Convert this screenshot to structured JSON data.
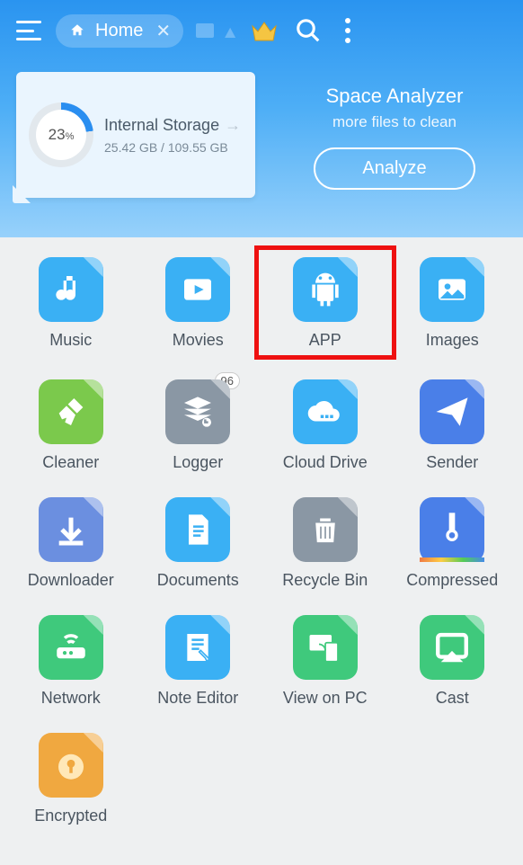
{
  "topbar": {
    "tab_label": "Home"
  },
  "storage": {
    "percent": "23",
    "percent_unit": "%",
    "title": "Internal Storage",
    "used": "25.42 GB",
    "total": "109.55 GB"
  },
  "analyzer": {
    "title": "Space Analyzer",
    "subtitle": "more files to clean",
    "button": "Analyze"
  },
  "tiles": [
    {
      "id": "music",
      "label": "Music",
      "color": "#3ab0f4",
      "icon": "music"
    },
    {
      "id": "movies",
      "label": "Movies",
      "color": "#3ab0f4",
      "icon": "play"
    },
    {
      "id": "app",
      "label": "APP",
      "color": "#3ab0f4",
      "icon": "android",
      "highlight": true
    },
    {
      "id": "images",
      "label": "Images",
      "color": "#3ab0f4",
      "icon": "image"
    },
    {
      "id": "cleaner",
      "label": "Cleaner",
      "color": "#7bc94c",
      "icon": "broom"
    },
    {
      "id": "logger",
      "label": "Logger",
      "color": "#8a97a4",
      "icon": "stack",
      "badge": "96"
    },
    {
      "id": "clouddrive",
      "label": "Cloud Drive",
      "color": "#3ab0f4",
      "icon": "cloud"
    },
    {
      "id": "sender",
      "label": "Sender",
      "color": "#4a7fe8",
      "icon": "send"
    },
    {
      "id": "downloader",
      "label": "Downloader",
      "color": "#6b8fe0",
      "icon": "download"
    },
    {
      "id": "documents",
      "label": "Documents",
      "color": "#3ab0f4",
      "icon": "doc"
    },
    {
      "id": "recyclebin",
      "label": "Recycle Bin",
      "color": "#8a97a4",
      "icon": "trash"
    },
    {
      "id": "compressed",
      "label": "Compressed",
      "color": "#4a7fe8",
      "icon": "zip"
    },
    {
      "id": "network",
      "label": "Network",
      "color": "#3fc97c",
      "icon": "router"
    },
    {
      "id": "noteeditor",
      "label": "Note Editor",
      "color": "#3ab0f4",
      "icon": "note"
    },
    {
      "id": "viewonpc",
      "label": "View on PC",
      "color": "#3fc97c",
      "icon": "pc"
    },
    {
      "id": "cast",
      "label": "Cast",
      "color": "#3fc97c",
      "icon": "cast"
    },
    {
      "id": "encrypted",
      "label": "Encrypted",
      "color": "#f0a840",
      "icon": "lock"
    }
  ]
}
